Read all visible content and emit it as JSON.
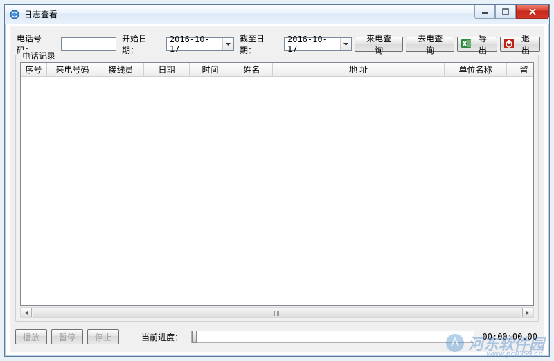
{
  "window": {
    "title": "日志查看"
  },
  "filter": {
    "phone_label": "电话号码：",
    "phone_value": "",
    "start_label": "开始日期：",
    "start_value": "2016-10-17",
    "end_label": "截至日期：",
    "end_value": "2016-10-17",
    "incoming_btn": "来电查询",
    "outgoing_btn": "去电查询",
    "export_btn": "导出",
    "exit_btn": "退出"
  },
  "records": {
    "group_label": "电话记录",
    "columns": [
      "序号",
      "来电号码",
      "接线员",
      "日期",
      "时间",
      "姓名",
      "地    址",
      "单位名称",
      "留"
    ],
    "rows": []
  },
  "playback": {
    "play": "播放",
    "pause": "暂停",
    "stop": "停止",
    "progress_label": "当前进度：",
    "time": "00:00:00.00"
  },
  "watermark": {
    "text": "河东软件园",
    "url": "www.pc0359.cn"
  }
}
